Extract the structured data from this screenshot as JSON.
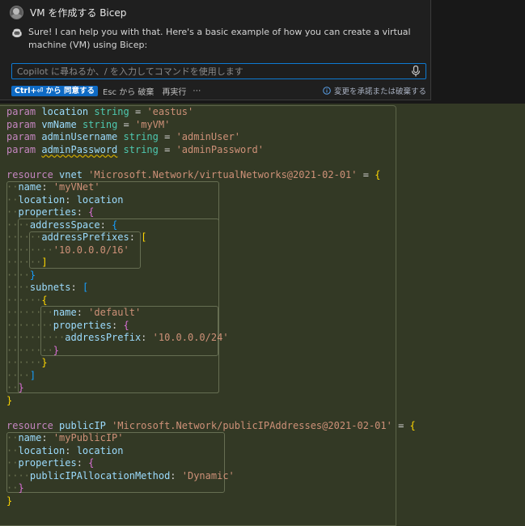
{
  "chat": {
    "title": "VM を作成する Bicep",
    "message": "Sure! I can help you with that. Here's a basic example of how you can create a virtual machine (VM) using Bicep:",
    "input_placeholder": "Copilot に尋ねるか、/ を入力してコマンドを使用します",
    "accept_label": "Ctrl+⏎ から 同意する",
    "discard_label": "Esc から 破棄",
    "rerun_label": "再実行",
    "more_label": "⋯",
    "status_text": "変更を承諾または破棄する"
  },
  "code_lines": [
    [
      [
        "kw-param",
        "param"
      ],
      [
        "op",
        " "
      ],
      [
        "id",
        "location"
      ],
      [
        "op",
        " "
      ],
      [
        "ty",
        "string"
      ],
      [
        "op",
        " = "
      ],
      [
        "str",
        "'eastus'"
      ]
    ],
    [
      [
        "kw-param",
        "param"
      ],
      [
        "op",
        " "
      ],
      [
        "id",
        "vmName"
      ],
      [
        "op",
        " "
      ],
      [
        "ty",
        "string"
      ],
      [
        "op",
        " = "
      ],
      [
        "str",
        "'myVM'"
      ]
    ],
    [
      [
        "kw-param",
        "param"
      ],
      [
        "op",
        " "
      ],
      [
        "id",
        "adminUsername"
      ],
      [
        "op",
        " "
      ],
      [
        "ty",
        "string"
      ],
      [
        "op",
        " = "
      ],
      [
        "str",
        "'adminUser'"
      ]
    ],
    [
      [
        "kw-param",
        "param"
      ],
      [
        "op",
        " "
      ],
      [
        "id squig",
        "adminPassword"
      ],
      [
        "op",
        " "
      ],
      [
        "ty",
        "string"
      ],
      [
        "op",
        " = "
      ],
      [
        "str",
        "'adminPassword'"
      ]
    ],
    [],
    [
      [
        "kw-param",
        "resource"
      ],
      [
        "op",
        " "
      ],
      [
        "id",
        "vnet"
      ],
      [
        "op",
        " "
      ],
      [
        "str",
        "'Microsoft.Network/virtualNetworks@2021-02-01'"
      ],
      [
        "op",
        " = "
      ],
      [
        "br1",
        "{"
      ]
    ],
    [
      [
        "dot",
        "··"
      ],
      [
        "id",
        "name"
      ],
      [
        "op",
        ": "
      ],
      [
        "str",
        "'myVNet'"
      ]
    ],
    [
      [
        "dot",
        "··"
      ],
      [
        "id",
        "location"
      ],
      [
        "op",
        ": "
      ],
      [
        "id",
        "location"
      ]
    ],
    [
      [
        "dot",
        "··"
      ],
      [
        "id",
        "properties"
      ],
      [
        "op",
        ": "
      ],
      [
        "br2",
        "{"
      ]
    ],
    [
      [
        "dot",
        "····"
      ],
      [
        "id",
        "addressSpace"
      ],
      [
        "op",
        ": "
      ],
      [
        "br3",
        "{"
      ]
    ],
    [
      [
        "dot",
        "······"
      ],
      [
        "id",
        "addressPrefixes"
      ],
      [
        "op",
        ": "
      ],
      [
        "br1",
        "["
      ]
    ],
    [
      [
        "dot",
        "········"
      ],
      [
        "str",
        "'10.0.0.0/16'"
      ]
    ],
    [
      [
        "dot",
        "······"
      ],
      [
        "br1",
        "]"
      ]
    ],
    [
      [
        "dot",
        "····"
      ],
      [
        "br3",
        "}"
      ]
    ],
    [
      [
        "dot",
        "····"
      ],
      [
        "id",
        "subnets"
      ],
      [
        "op",
        ": "
      ],
      [
        "br3",
        "["
      ]
    ],
    [
      [
        "dot",
        "······"
      ],
      [
        "br1",
        "{"
      ]
    ],
    [
      [
        "dot",
        "········"
      ],
      [
        "id",
        "name"
      ],
      [
        "op",
        ": "
      ],
      [
        "str",
        "'default'"
      ]
    ],
    [
      [
        "dot",
        "········"
      ],
      [
        "id",
        "properties"
      ],
      [
        "op",
        ": "
      ],
      [
        "br2",
        "{"
      ]
    ],
    [
      [
        "dot",
        "··········"
      ],
      [
        "id",
        "addressPrefix"
      ],
      [
        "op",
        ": "
      ],
      [
        "str",
        "'10.0.0.0/24'"
      ]
    ],
    [
      [
        "dot",
        "········"
      ],
      [
        "br2",
        "}"
      ]
    ],
    [
      [
        "dot",
        "······"
      ],
      [
        "br1",
        "}"
      ]
    ],
    [
      [
        "dot",
        "····"
      ],
      [
        "br3",
        "]"
      ]
    ],
    [
      [
        "dot",
        "··"
      ],
      [
        "br2",
        "}"
      ]
    ],
    [
      [
        "br1",
        "}"
      ]
    ],
    [],
    [
      [
        "kw-param",
        "resource"
      ],
      [
        "op",
        " "
      ],
      [
        "id",
        "publicIP"
      ],
      [
        "op",
        " "
      ],
      [
        "str",
        "'Microsoft.Network/publicIPAddresses@2021-02-01'"
      ],
      [
        "op",
        " = "
      ],
      [
        "br1",
        "{"
      ]
    ],
    [
      [
        "dot",
        "··"
      ],
      [
        "id",
        "name"
      ],
      [
        "op",
        ": "
      ],
      [
        "str",
        "'myPublicIP'"
      ]
    ],
    [
      [
        "dot",
        "··"
      ],
      [
        "id",
        "location"
      ],
      [
        "op",
        ": "
      ],
      [
        "id",
        "location"
      ]
    ],
    [
      [
        "dot",
        "··"
      ],
      [
        "id",
        "properties"
      ],
      [
        "op",
        ": "
      ],
      [
        "br2",
        "{"
      ]
    ],
    [
      [
        "dot",
        "····"
      ],
      [
        "id",
        "publicIPAllocationMethod"
      ],
      [
        "op",
        ": "
      ],
      [
        "str",
        "'Dynamic'"
      ]
    ],
    [
      [
        "dot",
        "··"
      ],
      [
        "br2",
        "}"
      ]
    ],
    [
      [
        "br1",
        "}"
      ]
    ]
  ]
}
